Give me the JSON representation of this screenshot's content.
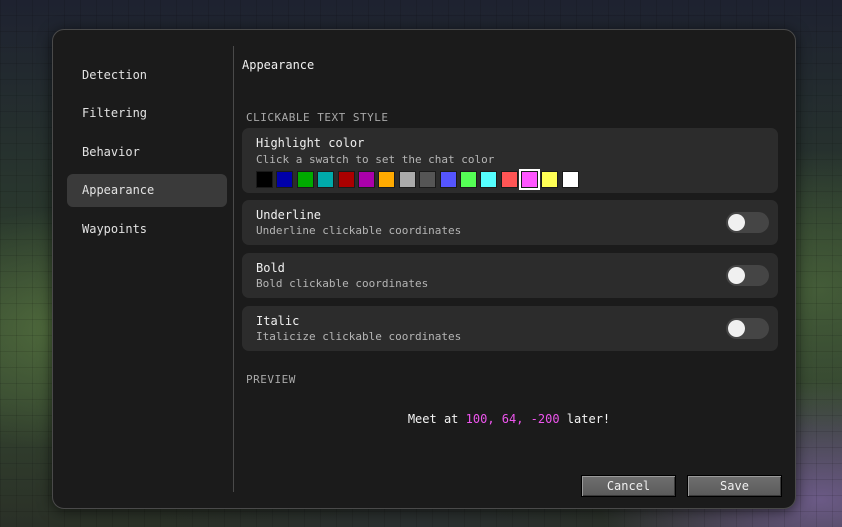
{
  "sidebar": {
    "items": [
      {
        "label": "Detection",
        "active": false
      },
      {
        "label": "Filtering",
        "active": false
      },
      {
        "label": "Behavior",
        "active": false
      },
      {
        "label": "Appearance",
        "active": true
      },
      {
        "label": "Waypoints",
        "active": false
      }
    ]
  },
  "main": {
    "title": "Appearance",
    "section_clickable": "CLICKABLE TEXT STYLE",
    "highlight": {
      "title": "Highlight color",
      "desc": "Click a swatch to set the chat color",
      "swatches": [
        "#000000",
        "#0000aa",
        "#00aa00",
        "#00aaaa",
        "#aa0000",
        "#aa00aa",
        "#ffaa00",
        "#aaaaaa",
        "#555555",
        "#5555ff",
        "#55ff55",
        "#55ffff",
        "#ff5555",
        "#ff55ff",
        "#ffff55",
        "#ffffff"
      ],
      "selected_index": 13
    },
    "underline": {
      "title": "Underline",
      "desc": "Underline clickable coordinates",
      "on": false
    },
    "bold": {
      "title": "Bold",
      "desc": "Bold clickable coordinates",
      "on": false
    },
    "italic": {
      "title": "Italic",
      "desc": "Italicize clickable coordinates",
      "on": false
    },
    "section_preview": "PREVIEW",
    "preview": {
      "before": "Meet at ",
      "c1": "100",
      "sep1": ", ",
      "c2": "64",
      "sep2": ", ",
      "c3": "-200",
      "after": " later!"
    }
  },
  "footer": {
    "cancel_label": "Cancel",
    "save_label": "Save"
  },
  "colors": {
    "accent": "#ff55ff",
    "panel": "#1b1b1b",
    "card": "#2c2c2c"
  }
}
